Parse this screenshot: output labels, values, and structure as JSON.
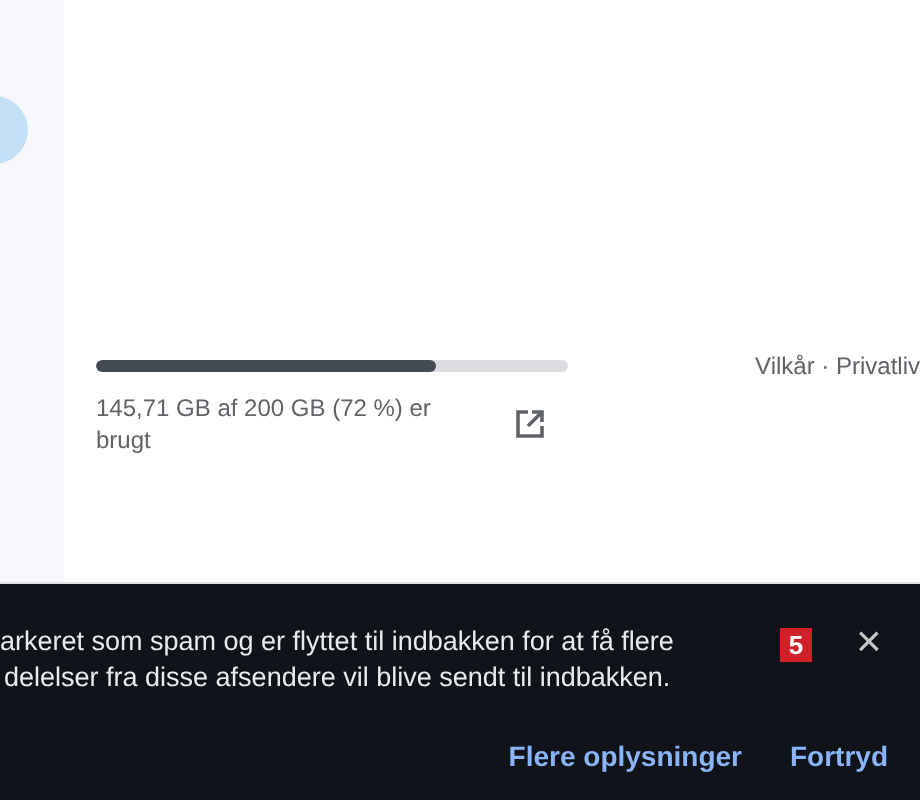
{
  "storage": {
    "level": 0.72,
    "text": "145,71 GB af 200 GB (72 %) er brugt"
  },
  "footer_links": "Vilkår · Privatliv",
  "snackbar": {
    "message_lines": [
      "arkeret som spam og er flyttet til indbakken for at få flere",
      "delelser fra disse afsendere vil blive sendt til indbakken."
    ],
    "badge": "5",
    "close": "×",
    "actions": [
      "Flere oplysninger",
      "Fortryd"
    ]
  }
}
